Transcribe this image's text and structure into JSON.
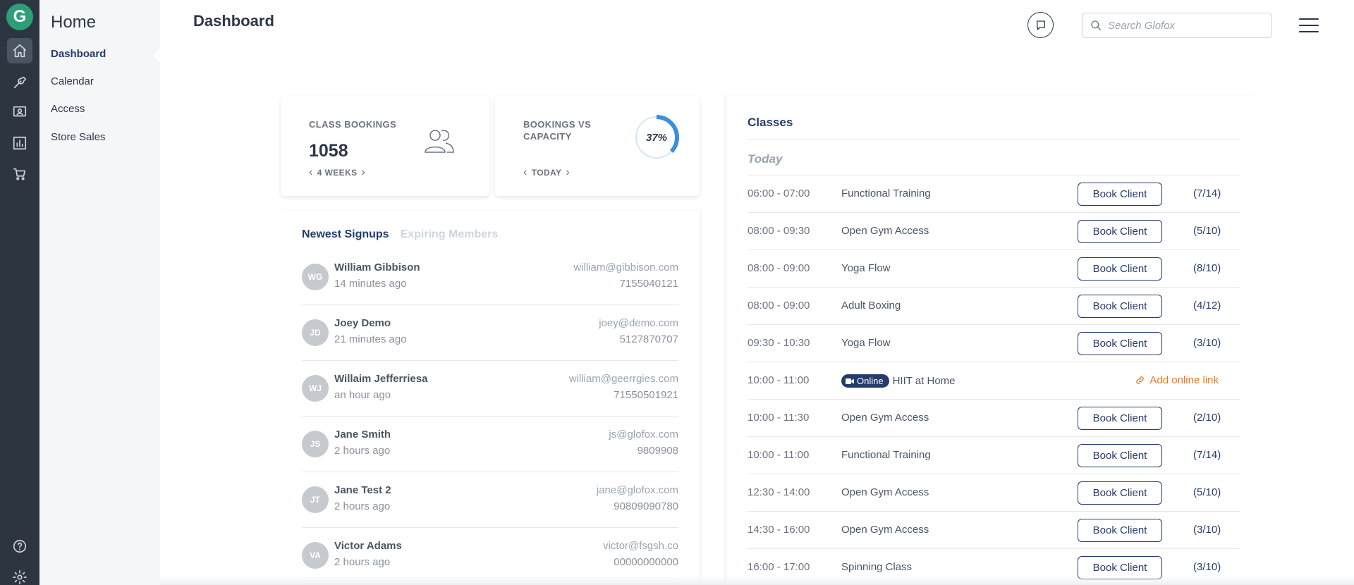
{
  "app": {
    "logo_letter": "G",
    "accent": "#2f9e77",
    "navy": "#243c6b",
    "link_orange": "#e07b24"
  },
  "rail": {
    "icons": [
      "home-icon",
      "wrench-icon",
      "member-card-icon",
      "bar-chart-icon",
      "cart-icon",
      "help-icon",
      "settings-icon"
    ]
  },
  "sidebar": {
    "title": "Home",
    "items": [
      {
        "label": "Dashboard",
        "active": true
      },
      {
        "label": "Calendar"
      },
      {
        "label": "Access"
      },
      {
        "label": "Store Sales"
      }
    ]
  },
  "header": {
    "title": "Dashboard",
    "search_placeholder": "Search Glofox"
  },
  "stats": {
    "bookings": {
      "label": "CLASS BOOKINGS",
      "value": "1058",
      "period": "4 WEEKS",
      "icon": "people-icon"
    },
    "capacity": {
      "label": "BOOKINGS VS CAPACITY",
      "value_text": "37%",
      "value": 37,
      "period": "TODAY"
    }
  },
  "signups": {
    "tabs": {
      "active": "Newest Signups",
      "inactive": "Expiring Members"
    },
    "members": [
      {
        "initials": "WG",
        "name": "William Gibbison",
        "time": "14 minutes ago",
        "email": "william@gibbison.com",
        "phone": "7155040121"
      },
      {
        "initials": "JD",
        "name": "Joey Demo",
        "time": "21 minutes ago",
        "email": "joey@demo.com",
        "phone": "5127870707"
      },
      {
        "initials": "WJ",
        "name": "Willaim Jefferriesa",
        "time": "an hour ago",
        "email": "william@geerrgies.com",
        "phone": "71550501921"
      },
      {
        "initials": "JS",
        "name": "Jane Smith",
        "time": "2 hours ago",
        "email": "js@glofox.com",
        "phone": "9809908"
      },
      {
        "initials": "JT",
        "name": "Jane Test 2",
        "time": "2 hours ago",
        "email": "jane@glofox.com",
        "phone": "90809090780"
      },
      {
        "initials": "VA",
        "name": "Victor Adams",
        "time": "2 hours ago",
        "email": "victor@fsgsh.co",
        "phone": "00000000000"
      }
    ]
  },
  "classes": {
    "title": "Classes",
    "day": "Today",
    "book_label": "Book Client",
    "online_label": "Online",
    "add_link_label": "Add online link",
    "rows": [
      {
        "time": "06:00 - 07:00",
        "name": "Functional Training",
        "capacity": "(7/14)"
      },
      {
        "time": "08:00 - 09:30",
        "name": "Open Gym Access",
        "capacity": "(5/10)"
      },
      {
        "time": "08:00 - 09:00",
        "name": "Yoga Flow",
        "capacity": "(8/10)"
      },
      {
        "time": "08:00 - 09:00",
        "name": "Adult Boxing",
        "capacity": "(4/12)"
      },
      {
        "time": "09:30 - 10:30",
        "name": "Yoga Flow",
        "capacity": "(3/10)"
      },
      {
        "time": "10:00 - 11:00",
        "name": "HIIT at Home",
        "online": true
      },
      {
        "time": "10:00 - 11:30",
        "name": "Open Gym Access",
        "capacity": "(2/10)"
      },
      {
        "time": "10:00 - 11:00",
        "name": "Functional Training",
        "capacity": "(7/14)"
      },
      {
        "time": "12:30 - 14:00",
        "name": "Open Gym Access",
        "capacity": "(5/10)"
      },
      {
        "time": "14:30 - 16:00",
        "name": "Open Gym Access",
        "capacity": "(3/10)"
      },
      {
        "time": "16:00 - 17:00",
        "name": "Spinning Class",
        "capacity": "(3/10)"
      }
    ]
  }
}
